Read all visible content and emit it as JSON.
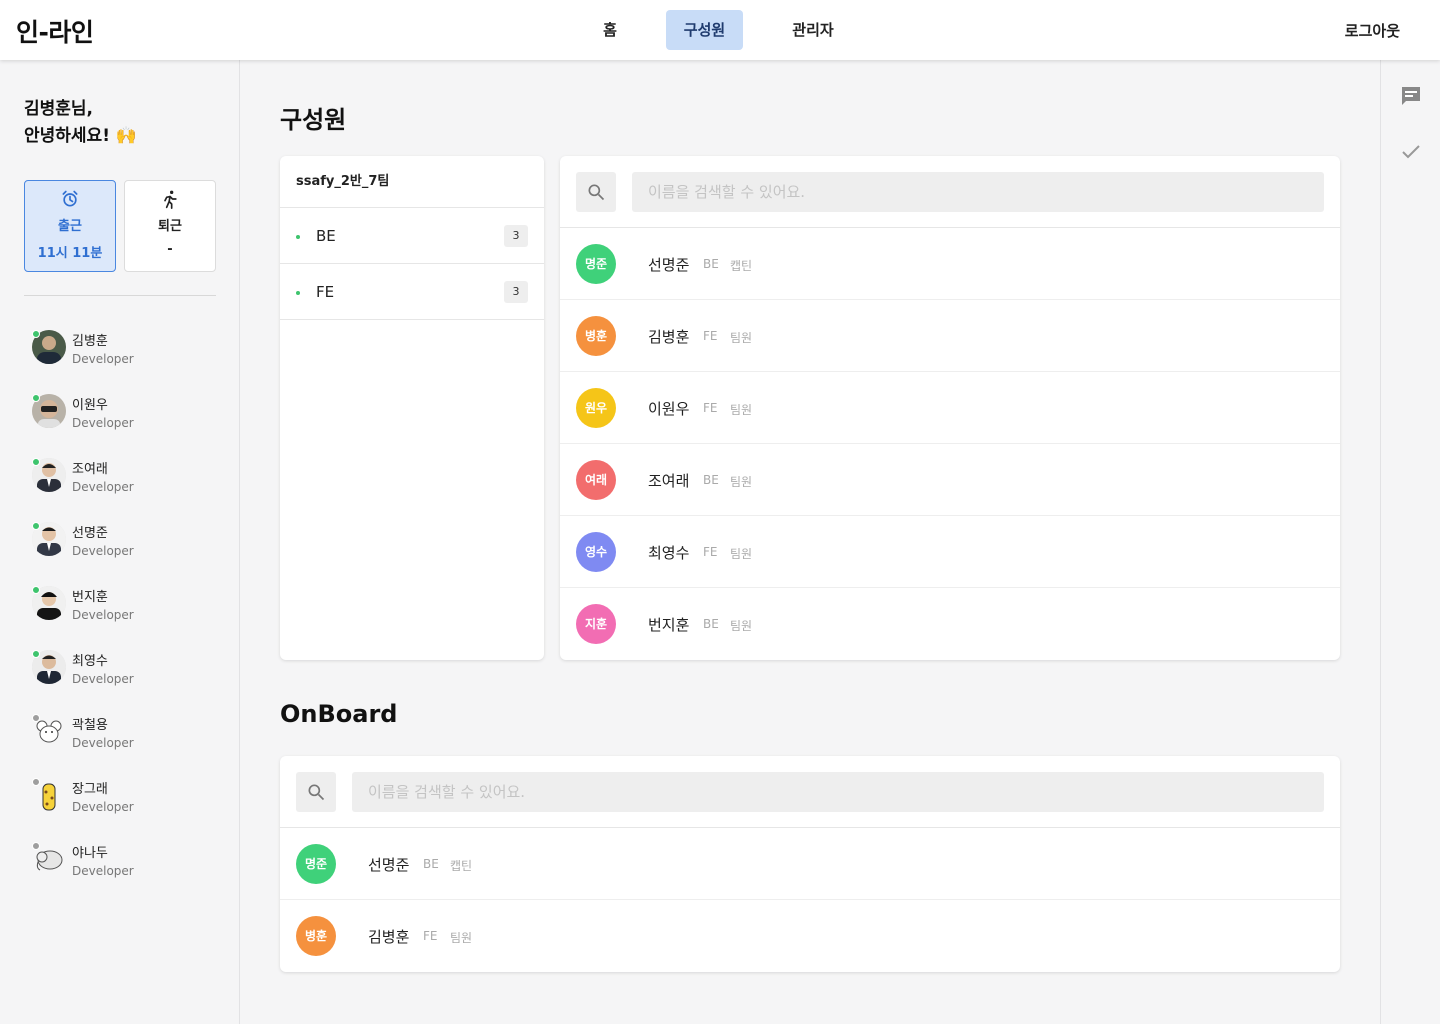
{
  "app": {
    "logo": "인-라인"
  },
  "nav": {
    "items": [
      {
        "label": "홈"
      },
      {
        "label": "구성원"
      },
      {
        "label": "관리자"
      }
    ],
    "active_label": "구성원",
    "logout_label": "로그아웃"
  },
  "sidebar": {
    "greeting_line1": "김병훈님,",
    "greeting_line2": "안녕하세요! 🙌",
    "check_in": {
      "label": "출근",
      "time": "11시 11분",
      "icon": "alarm-clock-icon"
    },
    "check_out": {
      "label": "퇴근",
      "time": "-",
      "icon": "running-person-icon"
    },
    "people": [
      {
        "name": "김병훈",
        "role": "Developer",
        "online": true
      },
      {
        "name": "이원우",
        "role": "Developer",
        "online": true
      },
      {
        "name": "조여래",
        "role": "Developer",
        "online": true
      },
      {
        "name": "선명준",
        "role": "Developer",
        "online": true
      },
      {
        "name": "번지훈",
        "role": "Developer",
        "online": true
      },
      {
        "name": "최영수",
        "role": "Developer",
        "online": true
      },
      {
        "name": "곽철용",
        "role": "Developer",
        "online": false
      },
      {
        "name": "장그래",
        "role": "Developer",
        "online": false
      },
      {
        "name": "야나두",
        "role": "Developer",
        "online": false
      }
    ]
  },
  "members_section": {
    "title": "구성원",
    "team_name": "ssafy_2반_7팀",
    "teams": [
      {
        "name": "BE",
        "count": "3"
      },
      {
        "name": "FE",
        "count": "3"
      }
    ],
    "search_placeholder": "이름을 검색할 수 있어요.",
    "members": [
      {
        "badge": "명준",
        "name": "선명준",
        "team": "BE",
        "role": "캡틴",
        "color": "#3fd17a"
      },
      {
        "badge": "병훈",
        "name": "김병훈",
        "team": "FE",
        "role": "팀원",
        "color": "#f5913e"
      },
      {
        "badge": "원우",
        "name": "이원우",
        "team": "FE",
        "role": "팀원",
        "color": "#f5c518"
      },
      {
        "badge": "여래",
        "name": "조여래",
        "team": "BE",
        "role": "팀원",
        "color": "#f26d6d"
      },
      {
        "badge": "영수",
        "name": "최영수",
        "team": "FE",
        "role": "팀원",
        "color": "#7f8af2"
      },
      {
        "badge": "지훈",
        "name": "번지훈",
        "team": "BE",
        "role": "팀원",
        "color": "#f26db3"
      }
    ]
  },
  "onboard_section": {
    "title": "OnBoard",
    "search_placeholder": "이름을 검색할 수 있어요.",
    "members": [
      {
        "badge": "명준",
        "name": "선명준",
        "team": "BE",
        "role": "캡틴",
        "color": "#3fd17a"
      },
      {
        "badge": "병훈",
        "name": "김병훈",
        "team": "FE",
        "role": "팀원",
        "color": "#f5913e"
      }
    ]
  },
  "rail": {
    "icons": [
      "chat-icon",
      "check-icon"
    ]
  }
}
